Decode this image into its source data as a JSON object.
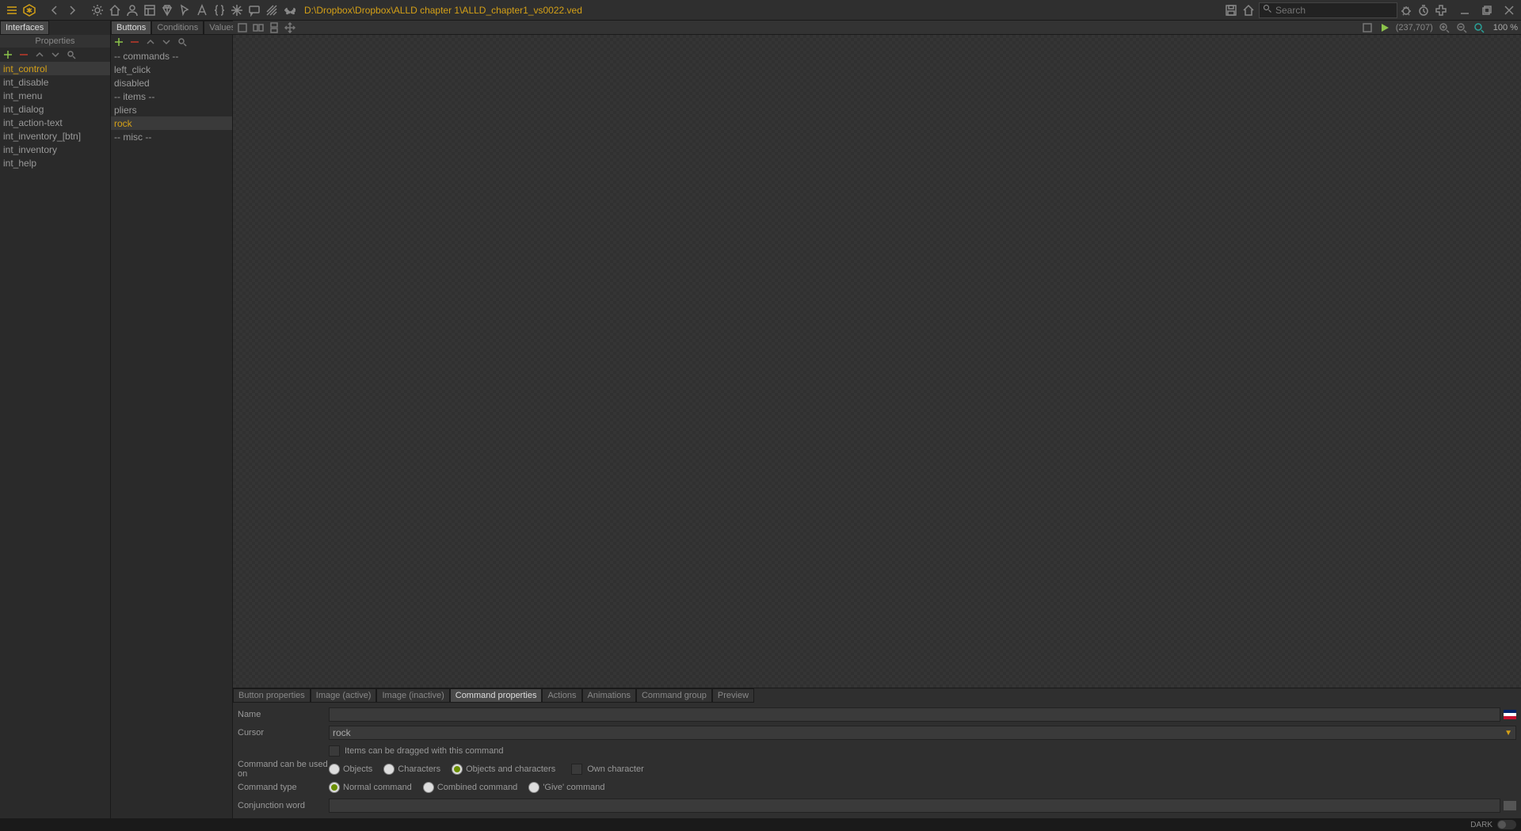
{
  "toolbar": {
    "file_path": "D:\\Dropbox\\Dropbox\\ALLD chapter 1\\ALLD_chapter1_vs0022.ved",
    "search_placeholder": "Search"
  },
  "sidebar_left": {
    "tab": "Interfaces",
    "section": "Properties",
    "items": [
      "int_control",
      "int_disable",
      "int_menu",
      "int_dialog",
      "int_action-text",
      "int_inventory_[btn]",
      "int_inventory",
      "int_help"
    ],
    "selected_index": 0
  },
  "sidebar_middle": {
    "tabs": [
      "Buttons",
      "Conditions",
      "Values"
    ],
    "active_tab": 0,
    "items": [
      "-- commands --",
      "left_click",
      "disabled",
      "-- items --",
      "pliers",
      "rock",
      "-- misc --"
    ],
    "selected_index": 5
  },
  "canvas": {
    "coords": "(237,707)",
    "zoom": "100 %"
  },
  "bottom": {
    "tabs": [
      "Button properties",
      "Image (active)",
      "Image (inactive)",
      "Command properties",
      "Actions",
      "Animations",
      "Command group",
      "Preview"
    ],
    "active_tab": 3,
    "form": {
      "name_label": "Name",
      "name_value": "",
      "cursor_label": "Cursor",
      "cursor_value": "rock",
      "drag_label": "Items can be dragged with this command",
      "used_on_label": "Command can be used on",
      "used_on_options": [
        "Objects",
        "Characters",
        "Objects and characters"
      ],
      "used_on_selected": 2,
      "own_char_label": "Own character",
      "type_label": "Command type",
      "type_options": [
        "Normal command",
        "Combined command",
        "'Give' command"
      ],
      "type_selected": 0,
      "conjunction_label": "Conjunction word",
      "conjunction_value": ""
    }
  },
  "status": {
    "theme": "DARK"
  }
}
